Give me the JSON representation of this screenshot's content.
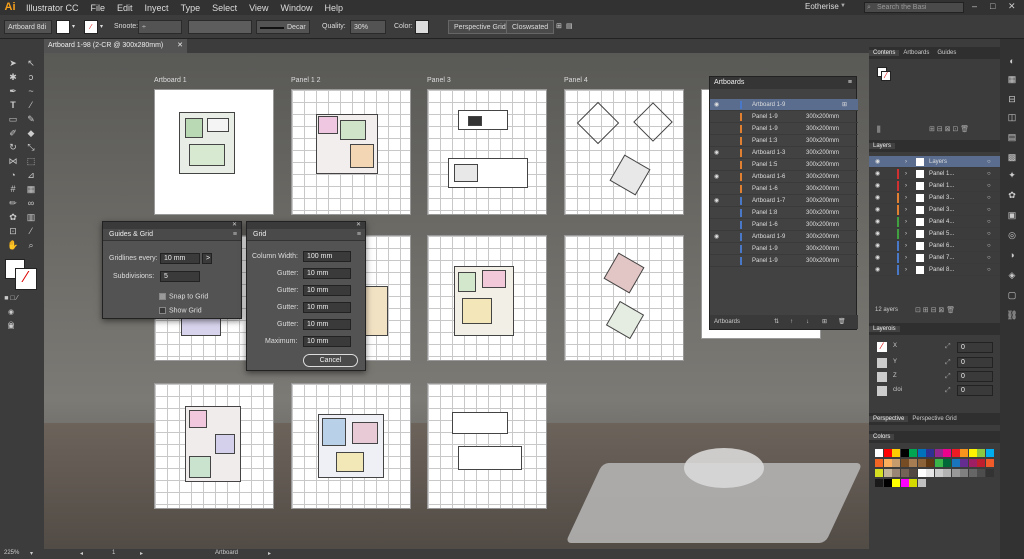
{
  "app": {
    "logo": "Ai",
    "name": "Illustrator CC"
  },
  "menu": [
    "File",
    "Edit",
    "Inyect",
    "Type",
    "Select",
    "View",
    "Window",
    "Help"
  ],
  "window": {
    "user": "Eotherise",
    "search_placeholder": "Search the Basi",
    "controls": [
      "–",
      "□",
      "✕"
    ]
  },
  "control_bar": {
    "artboard_label": "Artboard 8di",
    "stroke_label": "Snoote:",
    "stroke_style": "Decar",
    "quality_label": "Quality:",
    "quality_value": "30%",
    "color_label": "Color:",
    "button1": "Perspective Grid",
    "button2": "Closwsated"
  },
  "document_tab": {
    "title": "Artboard 1-98 (2-CR @ 300x280mm)",
    "close": "✕"
  },
  "artboards": [
    {
      "label": "Artboard 1",
      "type": "plan"
    },
    {
      "label": "Panel 1 2",
      "type": "plan"
    },
    {
      "label": "Panel 3",
      "type": "section"
    },
    {
      "label": "Panel 4",
      "type": "iso"
    },
    {
      "label": "",
      "type": "plan"
    },
    {
      "label": "",
      "type": "plan"
    },
    {
      "label": "",
      "type": "plan"
    },
    {
      "label": "",
      "type": "iso"
    },
    {
      "label": "",
      "type": "plan"
    },
    {
      "label": "",
      "type": "plan"
    },
    {
      "label": "",
      "type": "section"
    }
  ],
  "guides_dialog": {
    "title": "Guides & Grid",
    "gridlines_label": "Gridlines every:",
    "gridlines_value": "10 mm",
    "gridlines_arrow": ">",
    "subdivisions_label": "Subdivisions:",
    "subdivisions_value": "5",
    "snap_label": "Snap to Grid",
    "snap_checked": true,
    "show_label": "Show Grid",
    "show_checked": false
  },
  "grid_dialog": {
    "title": "Grid",
    "fields": [
      {
        "label": "Column Width:",
        "value": "100 mm"
      },
      {
        "label": "Gutter:",
        "value": "10 mm"
      },
      {
        "label": "Gutter:",
        "value": "10 mm"
      },
      {
        "label": "Gutter:",
        "value": "10 mm"
      },
      {
        "label": "Gutter:",
        "value": "10 mm"
      },
      {
        "label": "Maximum:",
        "value": "10 mm"
      }
    ],
    "cancel": "Cancel"
  },
  "artboards_panel": {
    "title": "Artboards",
    "footer": "Artboards",
    "rows": [
      {
        "name": "Artboard 1-9",
        "size": "",
        "color": "#4a78c8",
        "selected": true
      },
      {
        "name": "Panel 1-9",
        "size": "300x200mm",
        "color": "#e08030"
      },
      {
        "name": "Panel 1-9",
        "size": "300x200mm",
        "color": "#e08030"
      },
      {
        "name": "Panel 1:3",
        "size": "300x200mm",
        "color": "#e08030"
      },
      {
        "name": "Artboard 1-3",
        "size": "300x200mm",
        "color": "#e08030"
      },
      {
        "name": "Panel 1:5",
        "size": "300x200mm",
        "color": "#e08030"
      },
      {
        "name": "Artboard 1-6",
        "size": "300x200mm",
        "color": "#e08030"
      },
      {
        "name": "Panel 1-6",
        "size": "300x200mm",
        "color": "#e08030"
      },
      {
        "name": "Artboard 1-7",
        "size": "300x200mm",
        "color": "#4a78c8"
      },
      {
        "name": "Panel 1:8",
        "size": "300x200mm",
        "color": "#4a78c8"
      },
      {
        "name": "Panel 1-6",
        "size": "300x200mm",
        "color": "#4a78c8"
      },
      {
        "name": "Artboard 1-9",
        "size": "300x200mm",
        "color": "#4a78c8"
      },
      {
        "name": "Panel 1-9",
        "size": "300x200mm",
        "color": "#4a78c8"
      },
      {
        "name": "Panel 1-9",
        "size": "300x200mm",
        "color": "#4a78c8"
      }
    ]
  },
  "dock": {
    "top_tabs": [
      "Contens",
      "Artboards",
      "Guides"
    ],
    "layers_title": "Layers",
    "layers": [
      {
        "name": "Layers",
        "color": "#4a78c8",
        "selected": true
      },
      {
        "name": "Panel 1...",
        "color": "#d03030"
      },
      {
        "name": "Panel 1...",
        "color": "#d03030"
      },
      {
        "name": "Panel 3...",
        "color": "#e08030"
      },
      {
        "name": "Panel 3...",
        "color": "#e08030"
      },
      {
        "name": "Panel 4...",
        "color": "#40a040"
      },
      {
        "name": "Panel 5...",
        "color": "#40a040"
      },
      {
        "name": "Panel 6...",
        "color": "#4a78c8"
      },
      {
        "name": "Panel 7...",
        "color": "#4a78c8"
      },
      {
        "name": "Panel 8...",
        "color": "#4a78c8"
      }
    ],
    "layers_count": "12 ayers",
    "layerois_title": "Layerois",
    "layerois_rows": [
      {
        "k": "X",
        "v": "0"
      },
      {
        "k": "Y",
        "v": "0"
      },
      {
        "k": "Z",
        "v": "0"
      },
      {
        "k": "cloi",
        "v": "0"
      }
    ],
    "persp_tabs": [
      "Perspective",
      "Perspective Grid"
    ],
    "colors_title": "Colors",
    "swatches": [
      "#ffffff",
      "#ff0000",
      "#ffcc00",
      "#000000",
      "#00a651",
      "#0072bc",
      "#2e3192",
      "#92278f",
      "#ec008c",
      "#ed1c24",
      "#f7941d",
      "#fff200",
      "#8dc63f",
      "#00aeef",
      "#f26522",
      "#fbaf5d",
      "#c69c6d",
      "#754c24",
      "#a67c52",
      "#8c6239",
      "#603913",
      "#39b54a",
      "#006838",
      "#1b75bc",
      "#662d91",
      "#9e1f63",
      "#be1e2d",
      "#f15a29",
      "#d7df23",
      "#c2b59b",
      "#998675",
      "#736357",
      "#534741",
      "#ffffff",
      "#e6e6e6",
      "#cccccc",
      "#b3b3b3",
      "#999999",
      "#808080",
      "#666666",
      "#4d4d4d",
      "#333333",
      "#1a1a1a",
      "#000000",
      "#ffff00",
      "#ff00ff",
      "#d4d900",
      "#c0c0c0"
    ]
  },
  "status": {
    "zoom": "225%",
    "page": "1",
    "label": "Artboard"
  }
}
